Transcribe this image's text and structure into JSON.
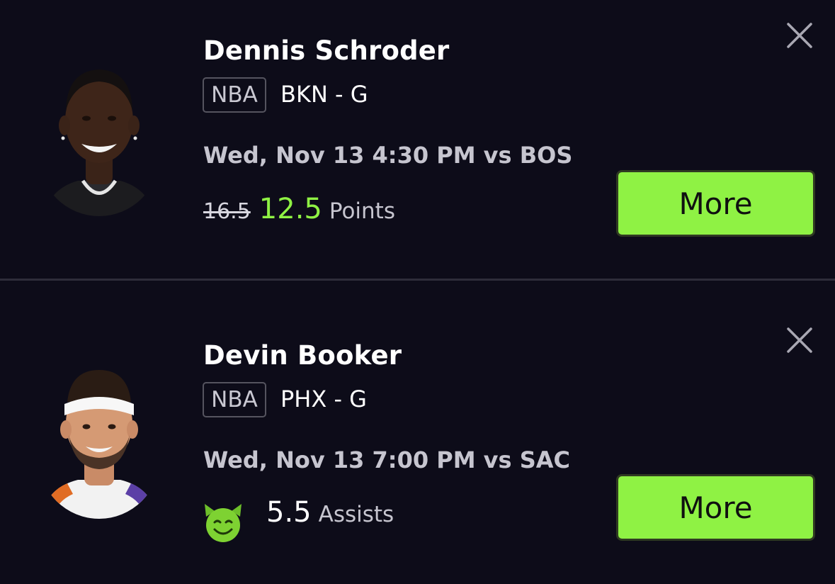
{
  "picks": [
    {
      "player_name": "Dennis Schroder",
      "league": "NBA",
      "team_position": "BKN - G",
      "game_info": "Wed, Nov 13 4:30 PM vs BOS",
      "old_line": "16.5",
      "line": "12.5",
      "stat": "Points",
      "more_label": "More",
      "close_icon": "close-icon",
      "accent_color": "#8ff244"
    },
    {
      "player_name": "Devin Booker",
      "league": "NBA",
      "team_position": "PHX - G",
      "game_info": "Wed, Nov 13 7:00 PM vs SAC",
      "line": "5.5",
      "stat": "Assists",
      "more_label": "More",
      "close_icon": "close-icon",
      "indicator_icon": "smiling-demon-icon"
    }
  ]
}
